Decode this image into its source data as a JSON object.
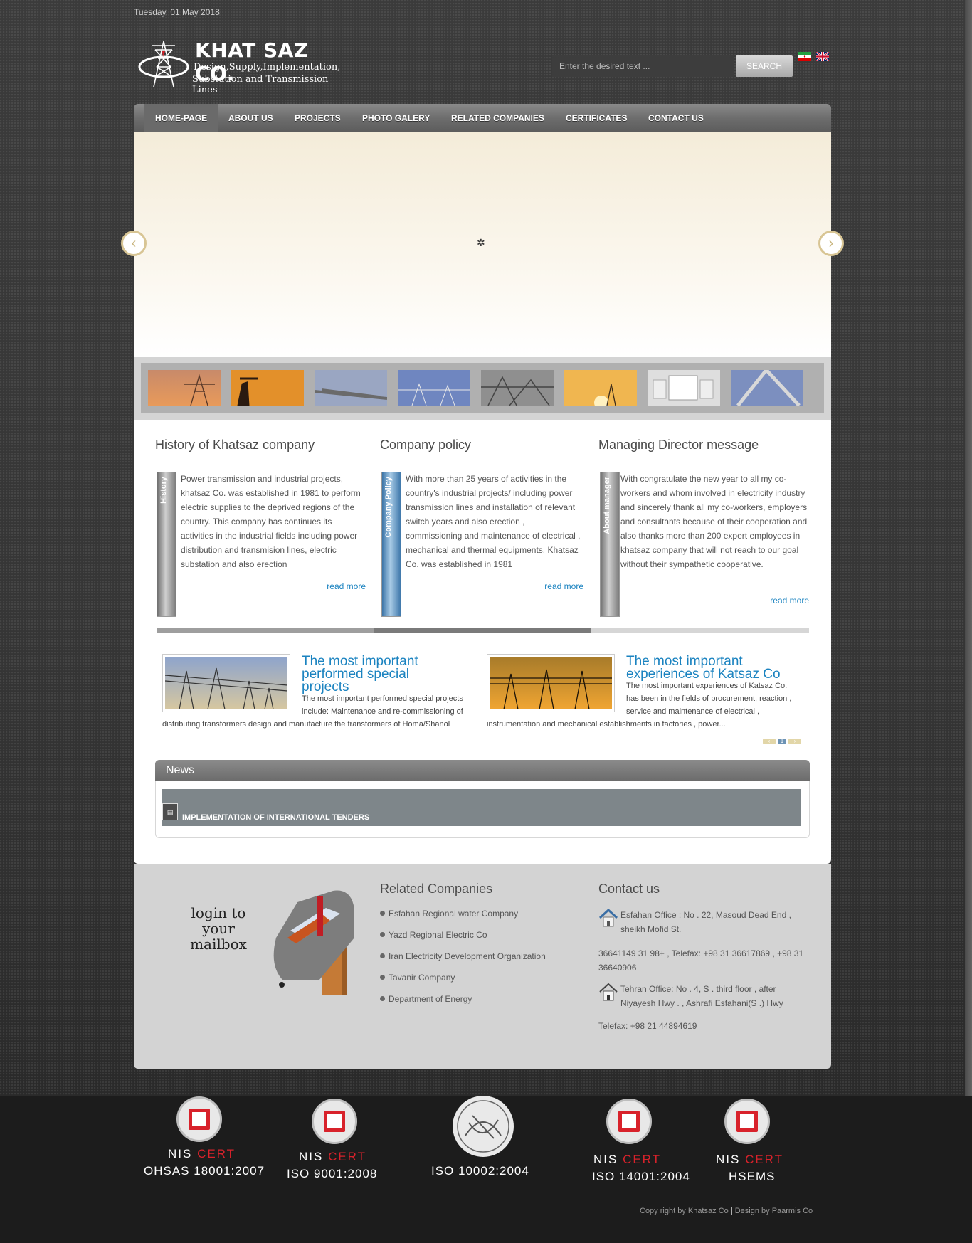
{
  "header": {
    "date": "Tuesday, 01 May 2018",
    "logo_title": "KHAT SAZ CO.",
    "logo_sub1": "Design,Supply,Implementation,",
    "logo_sub2": "Substation and Transmission Lines",
    "search_placeholder": "Enter the desired text ...",
    "search_button": "SEARCH"
  },
  "nav": {
    "items": [
      "HOME-PAGE",
      "ABOUT US",
      "PROJECTS",
      "PHOTO GALERY",
      "RELATED COMPANIES",
      "CERTIFICATES",
      "CONTACT US"
    ]
  },
  "sections": {
    "history": {
      "title": "History of Khatsaz company",
      "tab": "History",
      "text": "Power transmission and industrial projects, khatsaz Co. was established in 1981 to perform electric supplies to the deprived regions of the country. This company has continues its activities in the industrial fields including power distribution and transmision lines, electric substation and also erection",
      "read_more": "read more"
    },
    "policy": {
      "title": "Company policy",
      "tab": "Company Policy",
      "text": "With more than 25 years of activities in the country's industrial projects/ including power transmission lines and installation of relevant switch years and also erection , commissioning and maintenance of electrical , mechanical and thermal equipments, Khatsaz Co. was established in 1981",
      "read_more": "read more"
    },
    "director": {
      "title": "Managing Director message",
      "tab": "About manager",
      "text": "With congratulate the new year to all my co-workers and whom involved in electricity industry and sincerely thank all my co-workers, employers and consultants because of their cooperation and also thanks more than 200 expert employees in khatsaz company that will not reach to our goal without their sympathetic cooperative.",
      "read_more": "read more"
    }
  },
  "featured": [
    {
      "title": "The most important performed special projects",
      "text_top": "The most important performed special projects include: Maintenance and re-commissioning of",
      "text_bottom": "distributing transformers design and manufacture the transformers of Homa/Shanol"
    },
    {
      "title": "The most important experiences of Katsaz Co",
      "text_top": "The most important experiences of Katsaz Co. has been in the fields of procurement, reaction , service and maintenance of electrical ,",
      "text_bottom": "instrumentation and mechanical establishments in factories , power..."
    }
  ],
  "pager": {
    "page": "1"
  },
  "news": {
    "title": "News",
    "items": [
      "IMPLEMENTATION OF INTERNATIONAL TENDERS"
    ]
  },
  "footer": {
    "login_text": "login to your mailbox",
    "related_title": "Related Companies",
    "related": [
      "Esfahan Regional water Company",
      "Yazd Regional Electric Co",
      "Iran Electricity Development Organization",
      "Tavanir Company",
      "Department of Energy"
    ],
    "contact_title": "Contact us",
    "esfahan_office": "Esfahan Office : No . 22, Masoud Dead End , sheikh Mofid St.",
    "esfahan_phone": "36641149 31 98+ , Telefax: +98 31 36617869 , +98 31 36640906",
    "tehran_office": "Tehran Office: No . 4, S . third floor , after Niyayesh Hwy . , Ashrafi Esfahani(S .) Hwy",
    "tehran_phone": "Telefax:  +98 21 44894619"
  },
  "certificates": [
    {
      "line1a": "NIS ",
      "line1b": "CERT",
      "line2": "OHSAS 18001:2007"
    },
    {
      "line1a": "NIS ",
      "line1b": "CERT",
      "line2": "ISO 9001:2008"
    },
    {
      "line1a": "",
      "line1b": "",
      "line2": "ISO 10002:2004"
    },
    {
      "line1a": "NIS ",
      "line1b": "CERT",
      "line2": "ISO 14001:2004"
    },
    {
      "line1a": "NIS ",
      "line1b": "CERT",
      "line2": "HSEMS"
    }
  ],
  "copyright": {
    "left": "Copy right by Khatsaz Co",
    "sep": "|",
    "right": "Design by Paarmis Co"
  },
  "colors": {
    "accent_blue": "#1b83c0",
    "cert_red": "#d8222b",
    "nav_gray": "#6d6d6d"
  }
}
